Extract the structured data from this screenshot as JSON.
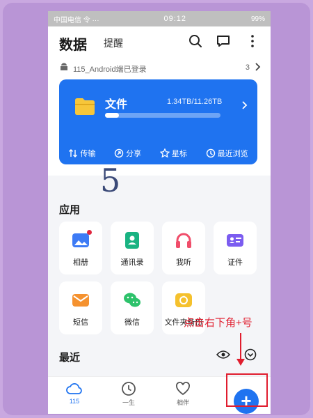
{
  "status_bar": {
    "carrier": "中国电信 令 ···",
    "time": "09:12",
    "battery": "99%"
  },
  "header": {
    "title": "数据",
    "tab_reminder": "提醒"
  },
  "login_notice": {
    "text": "115_Android端已登录",
    "count": "3"
  },
  "storage_card": {
    "title": "文件",
    "usage": "1.34TB/11.26TB",
    "usage_fraction": 0.12,
    "actions": [
      {
        "label": "传输",
        "icon": "transfer-icon"
      },
      {
        "label": "分享",
        "icon": "share-icon"
      },
      {
        "label": "星标",
        "icon": "star-icon"
      },
      {
        "label": "最近浏览",
        "icon": "clock-icon"
      }
    ]
  },
  "overlay_number": "5",
  "apps_section": {
    "title": "应用",
    "items": [
      {
        "label": "相册",
        "icon": "photo-icon",
        "color": "#3d7bf5"
      },
      {
        "label": "通讯录",
        "icon": "contacts-icon",
        "color": "#19b382"
      },
      {
        "label": "我听",
        "icon": "headphones-icon",
        "color": "#f04d6a"
      },
      {
        "label": "证件",
        "icon": "id-card-icon",
        "color": "#7b5cf0"
      },
      {
        "label": "短信",
        "icon": "message-icon",
        "color": "#f5922f"
      },
      {
        "label": "微信",
        "icon": "wechat-icon",
        "color": "#2dc26b"
      },
      {
        "label": "文件夹备份",
        "icon": "folder-backup-icon",
        "color": "#f5c12d"
      }
    ]
  },
  "recent_section": {
    "title": "最近"
  },
  "annotation": {
    "text": "点击右下角+号"
  },
  "bottom_nav": {
    "items": [
      {
        "label": "115",
        "icon": "cloud-icon"
      },
      {
        "label": "一生",
        "icon": "clock-icon"
      },
      {
        "label": "相伴",
        "icon": "heart-icon"
      }
    ],
    "fab_label": "+"
  },
  "colors": {
    "accent": "#1f73f0",
    "annotation_red": "#e01d2e",
    "page_bg": "#c9a8e0"
  }
}
